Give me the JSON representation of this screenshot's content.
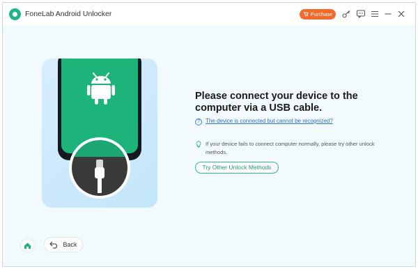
{
  "app": {
    "title": "FoneLab Android Unlocker"
  },
  "titlebar": {
    "purchase_label": "Purchase",
    "icons": [
      "key-icon",
      "feedback-icon",
      "menu-icon",
      "minimize-icon",
      "close-icon"
    ]
  },
  "main": {
    "heading_line1": "Please connect your device to the",
    "heading_line2": "computer via a USB cable.",
    "help_link": "The device is connected but cannot be recognized?",
    "tip_text": "If your device fails to connect computer normally, please try other unlock methods.",
    "try_button": "Try Other Unlock Methods"
  },
  "footer": {
    "back_label": "Back"
  },
  "colors": {
    "accent": "#1db47b",
    "purchase": "#f36b2b",
    "link": "#2f6dd0"
  }
}
